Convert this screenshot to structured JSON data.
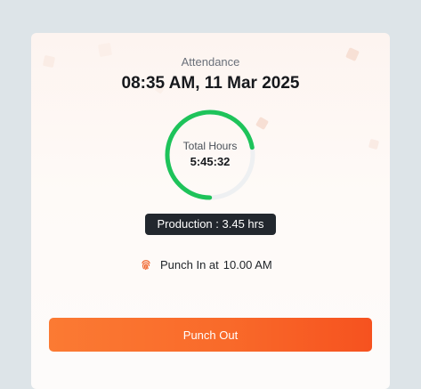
{
  "attendance": {
    "title": "Attendance",
    "datetime": "08:35 AM, 11 Mar 2025",
    "total_hours_label": "Total Hours",
    "total_hours_value": "5:45:32",
    "progress_fraction": 0.72,
    "production_label": "Production : 3.45 hrs",
    "punch_in_label": "Punch In at",
    "punch_in_time": "10.00 AM",
    "punch_out_button": "Punch Out"
  },
  "colors": {
    "accent": "#f96a2a",
    "ring_progress": "#1ec35a",
    "ring_track": "#eef0f2",
    "badge_bg": "#22272e"
  },
  "icons": {
    "punch_in": "fingerprint-icon"
  }
}
